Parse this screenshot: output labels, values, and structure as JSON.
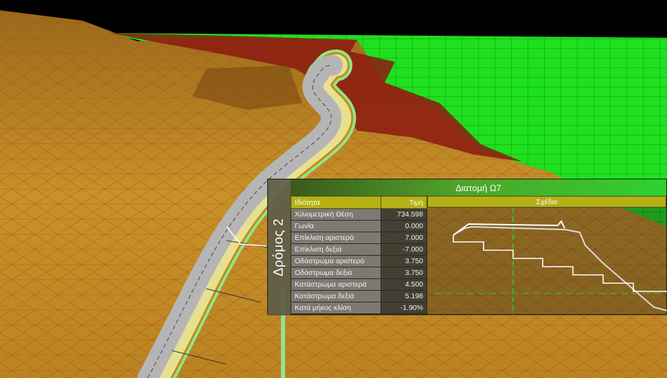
{
  "panel": {
    "side_tab": "Δρόμος 2",
    "title": "Διατομή Ω7",
    "columns": {
      "property": "Ιδιότητα",
      "value": "Τιμή",
      "drawing": "Σχέδιο"
    },
    "rows": [
      {
        "label": "Χιλιομετρική Θέση",
        "value": "734.598"
      },
      {
        "label": "Γωνία",
        "value": "0.000"
      },
      {
        "label": "Επίκλιση αριστερά",
        "value": "7.000"
      },
      {
        "label": "Επίκλιση δεξιά",
        "value": "-7.000"
      },
      {
        "label": "Οδόστρωμα αριστερά",
        "value": "3.750"
      },
      {
        "label": "Οδόστρωμα δεξιά",
        "value": "3.750"
      },
      {
        "label": "Κατάστρωμα αριστερά",
        "value": "4.500"
      },
      {
        "label": "Κατάστρωμα δεξιά",
        "value": "5.198"
      },
      {
        "label": "Κατά μήκος κλίση",
        "value": "-1.90%"
      }
    ]
  },
  "colors": {
    "sky": "#000000",
    "grid_plane": "#22ff22",
    "terrain": "#c8901e",
    "terrain_edges": "#cc1111",
    "road_surface": "#b5b5b5",
    "road_shoulder": "#e6e090",
    "road_verge": "#8ee68e",
    "header_accent": "#b5b014"
  }
}
